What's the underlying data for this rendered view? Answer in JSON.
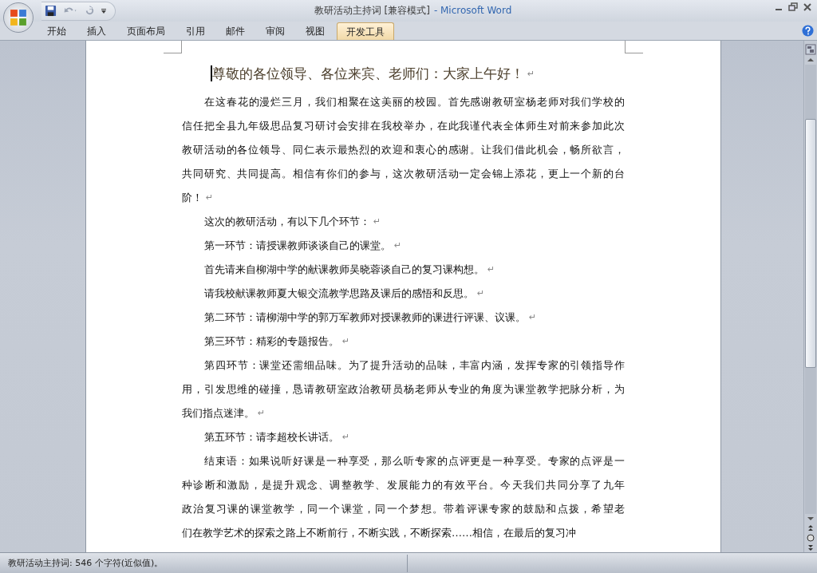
{
  "window": {
    "doc_title": "教研活动主持词 [兼容模式]",
    "app_name": "- Microsoft Word"
  },
  "ribbon_tabs": [
    {
      "label": "开始",
      "selected": false
    },
    {
      "label": "插入",
      "selected": false
    },
    {
      "label": "页面布局",
      "selected": false
    },
    {
      "label": "引用",
      "selected": false
    },
    {
      "label": "邮件",
      "selected": false
    },
    {
      "label": "审阅",
      "selected": false
    },
    {
      "label": "视图",
      "selected": false
    },
    {
      "label": "开发工具",
      "selected": true
    }
  ],
  "document": {
    "heading": {
      "text": "尊敬的各位领导、各位来宾、老师们：大家上午好！",
      "cursor": true,
      "end_mark": "↵"
    },
    "paragraphs": [
      {
        "lines": [
          "在这春花的漫烂三月，我们相聚在这美丽的校园。首先感谢教研室杨老师对我们学校的",
          "信任把全县九年级思品复习研讨会安排在我校举办，在此我谨代表全体师生对前来参加此次",
          "教研活动的各位领导、同仁表示最热烈的欢迎和衷心的感谢。让我们借此机会，畅所欲言，",
          "共同研究、共同提高。相信有你们的参与，这次教研活动一定会锦上添花，更上一个新的台",
          "阶！"
        ],
        "end_mark": "↵"
      },
      {
        "lines": [
          "这次的教研活动，有以下几个环节："
        ],
        "end_mark": "↵"
      },
      {
        "lines": [
          "第一环节：请授课教师谈谈自己的课堂。"
        ],
        "end_mark": "↵"
      },
      {
        "lines": [
          "首先请来自柳湖中学的献课教师吴晓蓉谈自己的复习课构想。"
        ],
        "end_mark": "↵"
      },
      {
        "lines": [
          "请我校献课教师夏大银交流教学思路及课后的感悟和反思。"
        ],
        "end_mark": "↵"
      },
      {
        "lines": [
          "第二环节：请柳湖中学的郭万军教师对授课教师的课进行评课、议课。"
        ],
        "end_mark": "↵"
      },
      {
        "lines": [
          "第三环节：精彩的专题报告。"
        ],
        "end_mark": "↵"
      },
      {
        "lines": [
          "第四环节：课堂还需细品味。为了提升活动的品味，丰富内涵，发挥专家的引领指导作",
          "用，引发思维的碰撞，恳请教研室政治教研员杨老师从专业的角度为课堂教学把脉分析，为",
          "我们指点迷津。"
        ],
        "end_mark": "↵"
      },
      {
        "lines": [
          "第五环节：请李超校长讲话。"
        ],
        "end_mark": "↵"
      },
      {
        "lines": [
          "结束语：如果说听好课是一种享受，那么听专家的点评更是一种享受。专家的点评是一",
          "种诊断和激励，是提升观念、调整教学、发展能力的有效平台。今天我们共同分享了九年",
          "政治复习课的课堂教学，同一个课堂，同一个梦想。带着评课专家的鼓励和点拨，希望老",
          "们在教学艺术的探索之路上不断前行，不断实践，不断探索……相信，在最后的复习冲"
        ]
      }
    ]
  },
  "status_bar": {
    "text": "教研活动主持词: 546 个字符(近似值)。"
  }
}
